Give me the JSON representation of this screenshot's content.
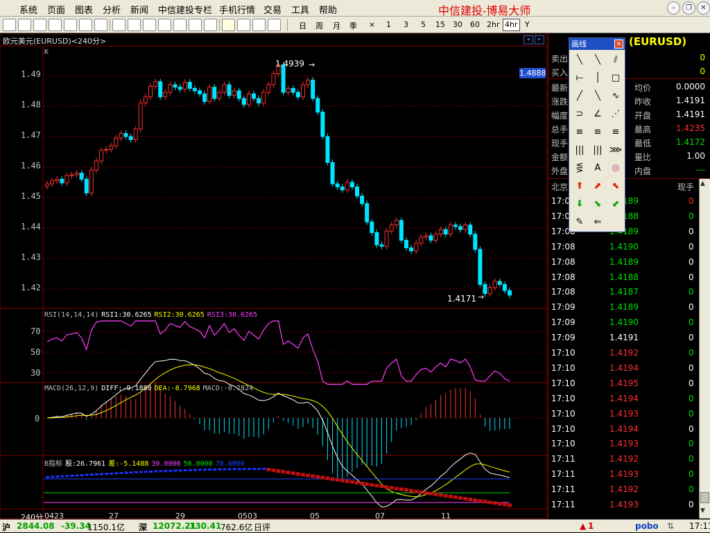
{
  "menu": {
    "items": [
      "系统",
      "页面",
      "图表",
      "分析",
      "新闻",
      "中信建投专栏",
      "手机行情",
      "交易",
      "工具",
      "帮助"
    ],
    "brand": "中信建投-博易大师"
  },
  "toolbar": {
    "periods": [
      "日",
      "周",
      "月",
      "季",
      "×",
      "1",
      "3",
      "5",
      "15",
      "30",
      "60",
      "2hr",
      "4hr",
      "Y"
    ],
    "selected_period": "4hr"
  },
  "chart": {
    "header": "欧元美元(EURUSD)<240分>",
    "k_label": "K",
    "y_ticks": [
      "1.49",
      "1.48",
      "1.47",
      "1.46",
      "1.45",
      "1.44",
      "1.43",
      "1.42"
    ],
    "last_price_tag": "1.4888",
    "high_annotation": "1.4939",
    "low_annotation": "1.4171",
    "x_ticks": [
      "0423",
      "27",
      "29",
      "0503",
      "05",
      "07",
      "11"
    ],
    "period_label": "240分",
    "rsi": {
      "title": "RSI(14,14,14)",
      "rsi1": "RSI1:30.6265",
      "rsi2": "RSI2:30.6265",
      "rsi3": "RSI3:30.6265",
      "ticks": [
        "70",
        "50",
        "30"
      ]
    },
    "macd": {
      "title": "MACD(26,12,9)",
      "diff": "DIFF:-9.1880",
      "dea": "DEA:-8.7968",
      "macd": "MACD:-0.7824",
      "zero": "0"
    },
    "b": {
      "title": "B指标",
      "v1": "股:26.7961",
      "v2": "差:-5.1488",
      "v3": "30.0000",
      "v4": "50.0000",
      "v5": "70.0000"
    }
  },
  "chart_data": {
    "type": "candlestick",
    "symbol": "EURUSD",
    "timeframe": "240分",
    "ylim": [
      1.4135,
      1.4995
    ],
    "close": [
      1.4545,
      1.4555,
      1.456,
      1.4548,
      1.4572,
      1.4575,
      1.458,
      1.456,
      1.4515,
      1.459,
      1.462,
      1.4655,
      1.4658,
      1.467,
      1.4695,
      1.471,
      1.47,
      1.469,
      1.4725,
      1.481,
      1.483,
      1.4865,
      1.488,
      1.483,
      1.4845,
      1.487,
      1.4862,
      1.4855,
      1.4878,
      1.4858,
      1.485,
      1.484,
      1.4815,
      1.4862,
      1.4825,
      1.4845,
      1.487,
      1.4835,
      1.485,
      1.4825,
      1.4805,
      1.484,
      1.4825,
      1.481,
      1.4845,
      1.487,
      1.4906,
      1.4935,
      1.4845,
      1.4858,
      1.4845,
      1.483,
      1.487,
      1.4885,
      1.4825,
      1.478,
      1.47,
      1.4615,
      1.4545,
      1.4535,
      1.4525,
      1.455,
      1.4535,
      1.4505,
      1.448,
      1.442,
      1.4385,
      1.4345,
      1.434,
      1.439,
      1.441,
      1.4425,
      1.436,
      1.4335,
      1.4325,
      1.435,
      1.437,
      1.4375,
      1.436,
      1.438,
      1.4395,
      1.438,
      1.441,
      1.4405,
      1.4395,
      1.441,
      1.438,
      1.433,
      1.4215,
      1.4185,
      1.4205,
      1.4225,
      1.4215,
      1.4195,
      1.418
    ]
  },
  "right": {
    "title": "(EURUSD)",
    "rows": [
      {
        "l": "卖出",
        "v": "0",
        "l2": "",
        "v2": ""
      },
      {
        "l": "买入",
        "v": "0",
        "l2": "",
        "v2": ""
      },
      {
        "l": "最新",
        "v": "",
        "l2": "均价",
        "v2": "0.0000"
      },
      {
        "l": "涨跌",
        "v": "",
        "l2": "昨收",
        "v2": "1.4191"
      },
      {
        "l": "幅度",
        "v": "",
        "l2": "开盘",
        "v2": "1.4191"
      },
      {
        "l": "总手",
        "v": "",
        "l2": "最高",
        "v2": "1.4235"
      },
      {
        "l": "现手",
        "v": "",
        "l2": "最低",
        "v2": "1.4172"
      },
      {
        "l": "金额",
        "v": "",
        "l2": "量比",
        "v2": "1.00"
      },
      {
        "l": "外盘",
        "v": "",
        "l2": "内盘",
        "v2": "---"
      }
    ],
    "tick_header": {
      "time": "北京",
      "price": "价格",
      "vol": "现手"
    },
    "ticks": [
      {
        "t": "17:09",
        "p": "1.4189",
        "c": "#00e000",
        "v": "0",
        "vc": "#ff3030"
      },
      {
        "t": "17:08",
        "p": "1.4188",
        "c": "#00e000",
        "v": "0",
        "vc": "#00e000"
      },
      {
        "t": "17:08",
        "p": "1.4189",
        "c": "#00e000",
        "v": "0",
        "vc": "#fff"
      },
      {
        "t": "17:08",
        "p": "1.4190",
        "c": "#00e000",
        "v": "0",
        "vc": "#fff"
      },
      {
        "t": "17:08",
        "p": "1.4189",
        "c": "#00e000",
        "v": "0",
        "vc": "#fff"
      },
      {
        "t": "17:08",
        "p": "1.4188",
        "c": "#00e000",
        "v": "0",
        "vc": "#fff"
      },
      {
        "t": "17:08",
        "p": "1.4187",
        "c": "#00e000",
        "v": "0",
        "vc": "#00e000"
      },
      {
        "t": "17:09",
        "p": "1.4189",
        "c": "#00e000",
        "v": "0",
        "vc": "#fff"
      },
      {
        "t": "17:09",
        "p": "1.4190",
        "c": "#00e000",
        "v": "0",
        "vc": "#00e000"
      },
      {
        "t": "17:09",
        "p": "1.4191",
        "c": "#fff",
        "v": "0",
        "vc": "#fff"
      },
      {
        "t": "17:10",
        "p": "1.4192",
        "c": "#ff3030",
        "v": "0",
        "vc": "#00e000"
      },
      {
        "t": "17:10",
        "p": "1.4194",
        "c": "#ff3030",
        "v": "0",
        "vc": "#fff"
      },
      {
        "t": "17:10",
        "p": "1.4195",
        "c": "#ff3030",
        "v": "0",
        "vc": "#fff"
      },
      {
        "t": "17:10",
        "p": "1.4194",
        "c": "#ff3030",
        "v": "0",
        "vc": "#00e000"
      },
      {
        "t": "17:10",
        "p": "1.4193",
        "c": "#ff3030",
        "v": "0",
        "vc": "#00e000"
      },
      {
        "t": "17:10",
        "p": "1.4194",
        "c": "#ff3030",
        "v": "0",
        "vc": "#fff"
      },
      {
        "t": "17:10",
        "p": "1.4193",
        "c": "#ff3030",
        "v": "0",
        "vc": "#00e000"
      },
      {
        "t": "17:11",
        "p": "1.4192",
        "c": "#ff3030",
        "v": "0",
        "vc": "#00e000"
      },
      {
        "t": "17:11",
        "p": "1.4193",
        "c": "#ff3030",
        "v": "0",
        "vc": "#00e000"
      },
      {
        "t": "17:11",
        "p": "1.4192",
        "c": "#ff3030",
        "v": "0",
        "vc": "#00e000"
      },
      {
        "t": "17:11",
        "p": "1.4193",
        "c": "#ff3030",
        "v": "0",
        "vc": "#fff"
      }
    ]
  },
  "drawtool": {
    "title": "画线",
    "close": "×",
    "text_tool": "A"
  },
  "status": {
    "sh_label": "沪",
    "sh_index": "2844.08",
    "sh_change": "-39.34",
    "sh_amount": "1150.1亿",
    "sz_label": "深",
    "sz_index": "12072.21",
    "sz_change": "-130.41",
    "sz_amount": "762.6亿",
    "day_review": "日评",
    "alert_count": "1",
    "brand": "pobo",
    "time": "17:11"
  },
  "colors": {
    "up": "#ff3030",
    "down": "#00e5ff",
    "grid": "#800000",
    "bg": "#000000",
    "green": "#00e000",
    "yellow": "#ffff00",
    "magenta": "#ff40ff"
  }
}
